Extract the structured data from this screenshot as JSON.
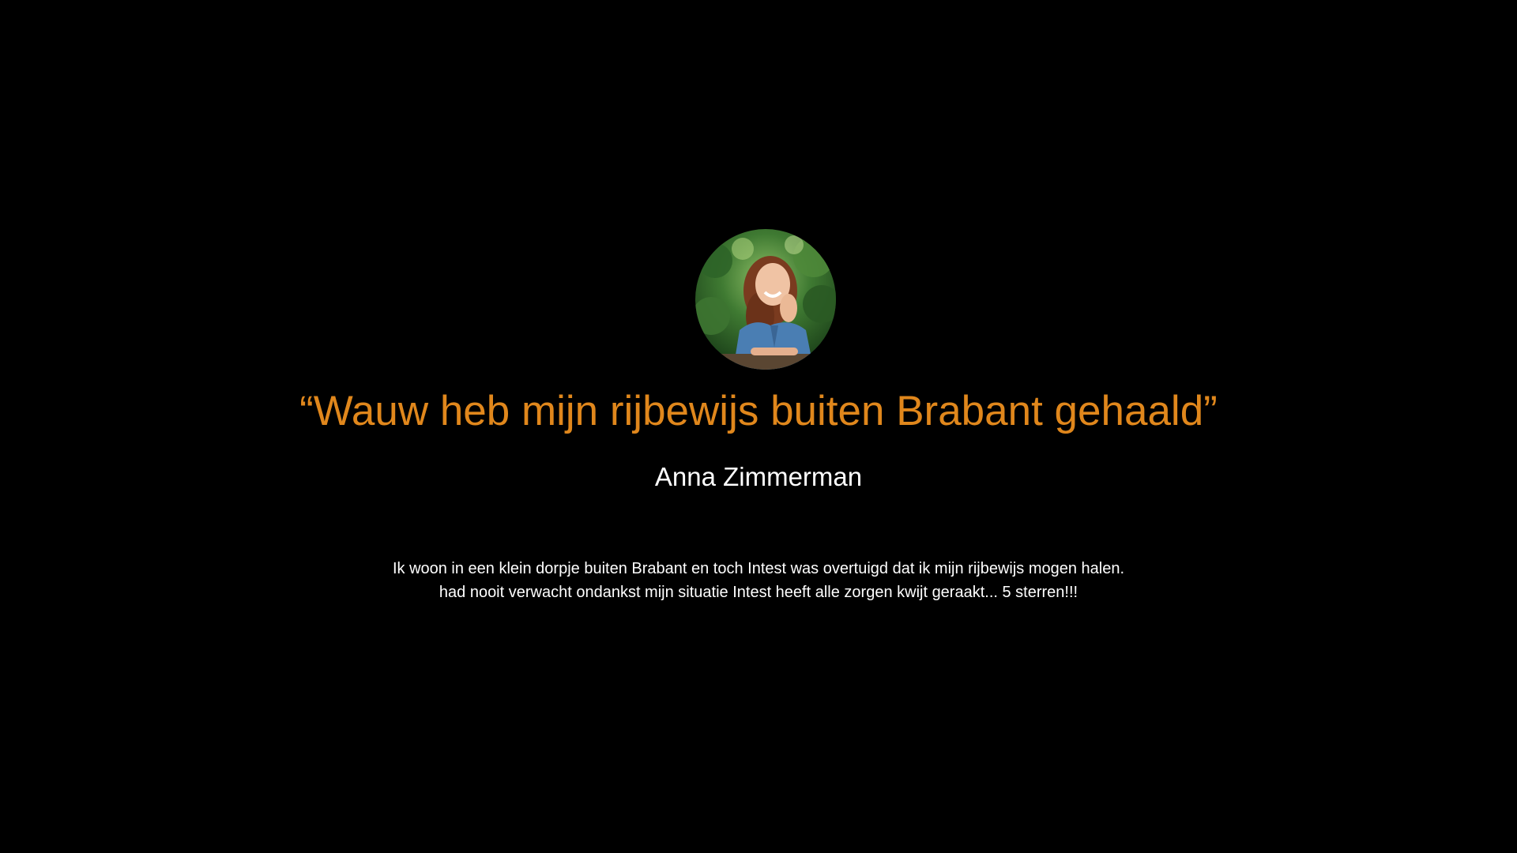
{
  "colors": {
    "background": "#000000",
    "accent": "#e0871c",
    "text": "#ffffff"
  },
  "testimonial": {
    "photo": "avatar-photo-smiling-woman",
    "quote": "“Wauw heb mijn rijbewijs buiten Brabant gehaald”",
    "author": "Anna Zimmerman",
    "body_lines": [
      "Ik woon in een klein dorpje buiten Brabant en toch Intest was overtuigd dat ik mijn rijbewijs mogen halen.",
      "had nooit verwacht ondankst mijn situatie Intest heeft alle zorgen kwijt geraakt... 5 sterren!!!"
    ]
  }
}
